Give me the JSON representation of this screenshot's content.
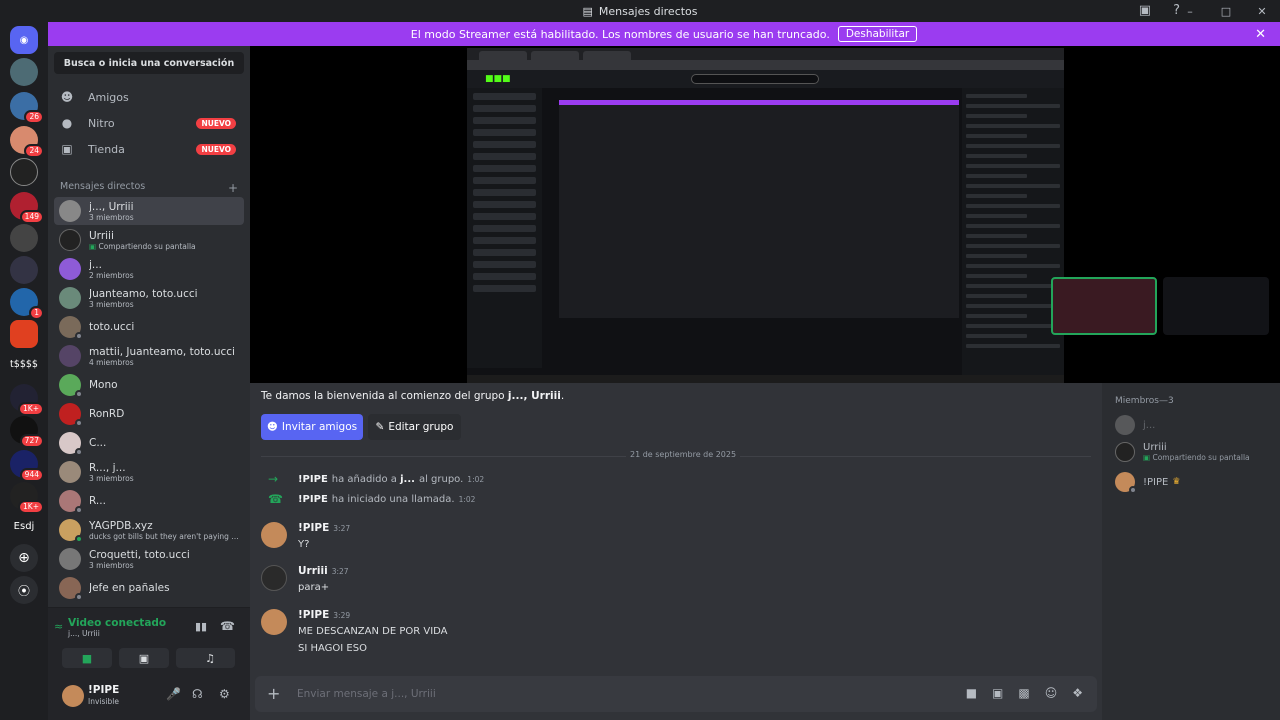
{
  "window": {
    "title": "Mensajes directos"
  },
  "streamer_bar": {
    "message": "El modo Streamer está habilitado. Los nombres de usuario se han truncado.",
    "button": "Deshabilitar"
  },
  "servers": [
    {
      "label": "",
      "badge": ""
    },
    {
      "label": "",
      "badge": ""
    },
    {
      "label": "",
      "badge": "26"
    },
    {
      "label": "",
      "badge": "24"
    },
    {
      "label": "",
      "badge": ""
    },
    {
      "label": "",
      "badge": "149"
    },
    {
      "label": "",
      "badge": ""
    },
    {
      "label": "",
      "badge": ""
    },
    {
      "label": "",
      "badge": "1"
    },
    {
      "label": "",
      "badge": ""
    },
    {
      "label": "t$$$$",
      "badge": ""
    },
    {
      "label": "",
      "badge": "1K+"
    },
    {
      "label": "",
      "badge": "727"
    },
    {
      "label": "",
      "badge": "944"
    },
    {
      "label": "",
      "badge": "1K+"
    },
    {
      "label": "Esdj",
      "badge": ""
    }
  ],
  "dm_panel": {
    "search": "Busca o inicia una conversación",
    "nav": [
      {
        "label": "Amigos",
        "badge": ""
      },
      {
        "label": "Nitro",
        "badge": "NUEVO"
      },
      {
        "label": "Tienda",
        "badge": "NUEVO"
      }
    ],
    "header": "Mensajes directos",
    "items": [
      {
        "name": "j..., Urriii",
        "sub": "3 miembros"
      },
      {
        "name": "Urriii",
        "sub": "Compartiendo su pantalla"
      },
      {
        "name": "j...",
        "sub": "2 miembros"
      },
      {
        "name": "Juanteamo, toto.ucci",
        "sub": "3 miembros"
      },
      {
        "name": "toto.ucci",
        "sub": ""
      },
      {
        "name": "mattii, Juanteamo, toto.ucci",
        "sub": "4 miembros"
      },
      {
        "name": "Mono",
        "sub": ""
      },
      {
        "name": "RonRD",
        "sub": ""
      },
      {
        "name": "C...",
        "sub": ""
      },
      {
        "name": "R..., j...",
        "sub": "3 miembros"
      },
      {
        "name": "R...",
        "sub": ""
      },
      {
        "name": "YAGPDB.xyz",
        "sub": "ducks got bills but they aren't paying for ..."
      },
      {
        "name": "Croquetti, toto.ucci",
        "sub": "3 miembros"
      },
      {
        "name": "Jefe en pañales",
        "sub": ""
      }
    ]
  },
  "voice": {
    "status": "Video conectado",
    "channel": "j..., Urriii"
  },
  "user": {
    "name": "!PIPE",
    "status": "Invisible"
  },
  "chat": {
    "welcome_prefix": "Te damos la bienvenida al comienzo del grupo ",
    "welcome_group": "j..., Urriii",
    "welcome_suffix": ".",
    "invite_button": "Invitar amigos",
    "edit_button": "Editar grupo",
    "date": "21 de septiembre de 2025",
    "system": [
      {
        "user": "!PIPE",
        "action": "ha añadido a",
        "target": "j...",
        "rest": "al grupo.",
        "time": "1:02"
      },
      {
        "user": "!PIPE",
        "action": "ha iniciado una llamada.",
        "target": "",
        "rest": "",
        "time": "1:02"
      }
    ],
    "messages": [
      {
        "author": "!PIPE",
        "time": "3:27",
        "lines": [
          "Y?"
        ]
      },
      {
        "author": "Urriii",
        "time": "3:27",
        "lines": [
          "para+"
        ]
      },
      {
        "author": "!PIPE",
        "time": "3:29",
        "lines": [
          "ME DESCANZAN DE POR VIDA",
          "SI HAGOI ESO"
        ]
      }
    ],
    "composer_placeholder": "Enviar mensaje a j..., Urriii"
  },
  "members": {
    "header": "Miembros—3",
    "list": [
      {
        "name": "j...",
        "sub": ""
      },
      {
        "name": "Urriii",
        "sub": "Compartiendo su pantalla"
      },
      {
        "name": "!PIPE",
        "sub": ""
      }
    ]
  }
}
